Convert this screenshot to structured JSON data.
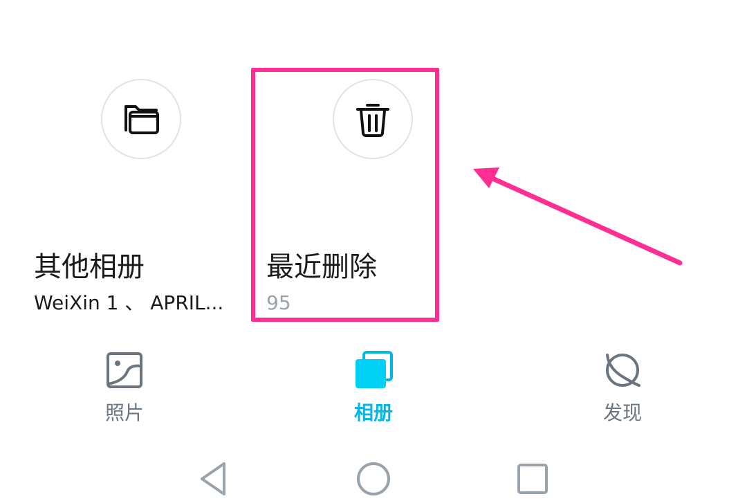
{
  "albums": [
    {
      "title": "其他相册",
      "subtitle": "WeiXin 1 、 APRIL...",
      "icon": "folder-icon"
    },
    {
      "title": "最近删除",
      "subtitle": "95",
      "icon": "trash-icon"
    }
  ],
  "tabs": [
    {
      "label": "照片",
      "icon": "photo-icon",
      "active": false
    },
    {
      "label": "相册",
      "icon": "albums-icon",
      "active": true
    },
    {
      "label": "发现",
      "icon": "discover-icon",
      "active": false
    }
  ],
  "colors": {
    "accent": "#00b8e6",
    "highlight": "#ff2e93",
    "inactive_tab": "#6b7580",
    "muted_text": "#9aa3ab"
  },
  "system_nav": [
    "back-icon",
    "home-icon",
    "recents-icon"
  ]
}
